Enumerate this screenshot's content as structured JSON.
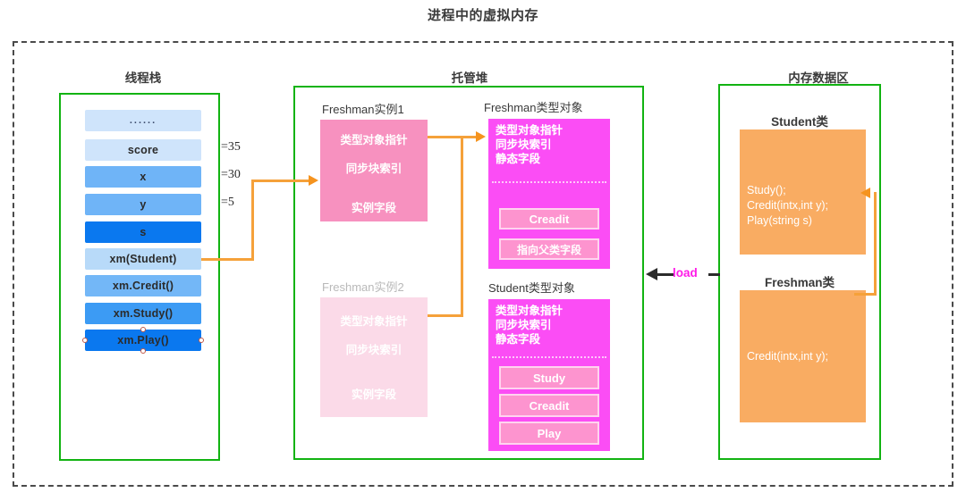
{
  "title": "进程中的虚拟内存",
  "regions": {
    "thread_stack": {
      "header": "线程栈"
    },
    "managed_heap": {
      "header": "托管堆"
    },
    "memory_data_area": {
      "header": "内存数据区"
    }
  },
  "thread_stack": {
    "slots": [
      {
        "label": "......",
        "color": "#cfe4fb"
      },
      {
        "label": "score",
        "color": "#cfe4fb"
      },
      {
        "label": "x",
        "color": "#6fb4f7"
      },
      {
        "label": "y",
        "color": "#6fb4f7"
      },
      {
        "label": "s",
        "color": "#0a78ef"
      },
      {
        "label": "xm(Student)",
        "color": "#b8daf9"
      },
      {
        "label": "xm.Credit()",
        "color": "#73b7f7"
      },
      {
        "label": "xm.Study()",
        "color": "#3c9bf4"
      },
      {
        "label": "xm.Play()",
        "color": "#0a78ef"
      }
    ],
    "selected_slot": "xm.Play()",
    "annotations": [
      {
        "text": "=35"
      },
      {
        "text": "=30"
      },
      {
        "text": "=5"
      }
    ]
  },
  "heap": {
    "instance1": {
      "caption": "Freshman实例1",
      "lines": [
        "类型对象指针",
        "同步块索引",
        "实例字段"
      ]
    },
    "instance2": {
      "caption": "Freshman实例2",
      "lines": [
        "类型对象指针",
        "同步块索引",
        "实例字段"
      ]
    },
    "freshman_type": {
      "caption": "Freshman类型对象",
      "header_lines": [
        "类型对象指针",
        "同步块索引",
        "静态字段"
      ],
      "methods": [
        "Creadit",
        "指向父类字段"
      ]
    },
    "student_type": {
      "caption": "Student类型对象",
      "header_lines": [
        "类型对象指针",
        "同步块索引",
        "静态字段"
      ],
      "methods": [
        "Study",
        "Creadit",
        "Play"
      ]
    }
  },
  "memory_data_area": {
    "student_class": {
      "title": "Student类",
      "code": [
        "Study();",
        "Credit(intx,int y);",
        "Play(string s)"
      ]
    },
    "freshman_class": {
      "title": "Freshman类",
      "code": [
        "Credit(intx,int y);"
      ]
    }
  },
  "connectors": {
    "load_label": "load"
  },
  "colors": {
    "frame": "#4a4a4a",
    "region_border": "#12b312",
    "instance": "#f791bf",
    "instance_faded": "#fbdae8",
    "type_object": "#fb4df5",
    "method_chip": "#fd94cf",
    "orange": "#f9ac62",
    "connector": "#f5a13a",
    "load_label": "#ff1ae8"
  }
}
